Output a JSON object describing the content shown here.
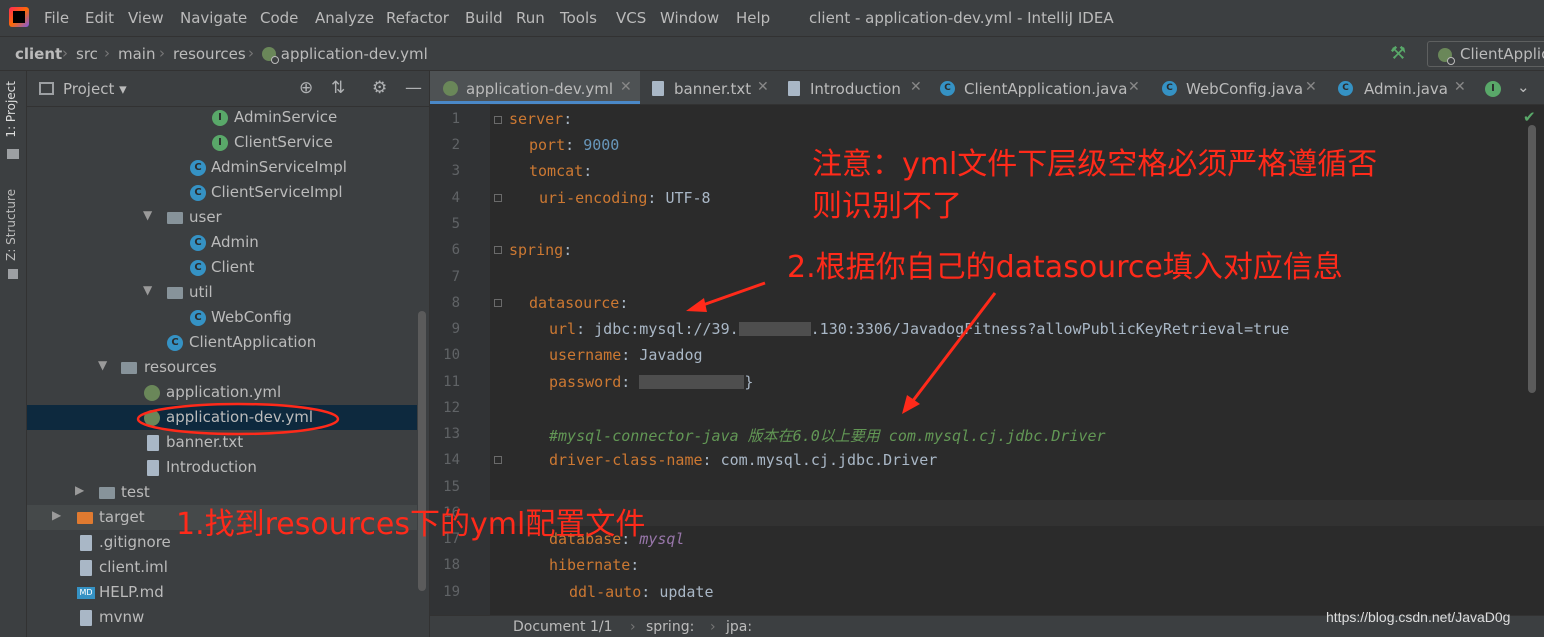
{
  "colors": {
    "accent": "#4a88c7",
    "annotation": "#ff2a1a",
    "selection": "#0d293e"
  },
  "window": {
    "title": "client - application-dev.yml - IntelliJ IDEA"
  },
  "menu": [
    "File",
    "Edit",
    "View",
    "Navigate",
    "Code",
    "Analyze",
    "Refactor",
    "Build",
    "Run",
    "Tools",
    "VCS",
    "Window",
    "Help"
  ],
  "breadcrumb": [
    "client",
    "src",
    "main",
    "resources",
    "application-dev.yml"
  ],
  "run_config": "ClientApplic",
  "left_strip": {
    "project": "1: Project",
    "structure": "Z: Structure"
  },
  "project_panel": {
    "title": "Project"
  },
  "tree": [
    {
      "label": "AdminService",
      "icon": "interface-icon"
    },
    {
      "label": "ClientService",
      "icon": "interface-icon"
    },
    {
      "label": "AdminServiceImpl",
      "icon": "class-icon"
    },
    {
      "label": "ClientServiceImpl",
      "icon": "class-icon"
    },
    {
      "label": "user",
      "icon": "package-icon"
    },
    {
      "label": "Admin",
      "icon": "class-icon"
    },
    {
      "label": "Client",
      "icon": "class-icon"
    },
    {
      "label": "util",
      "icon": "package-icon"
    },
    {
      "label": "WebConfig",
      "icon": "class-icon"
    },
    {
      "label": "ClientApplication",
      "icon": "spring-boot-icon"
    },
    {
      "label": "resources",
      "icon": "resources-folder-icon"
    },
    {
      "label": "application.yml",
      "icon": "yml-icon"
    },
    {
      "label": "application-dev.yml",
      "icon": "yml-icon"
    },
    {
      "label": "banner.txt",
      "icon": "text-file-icon"
    },
    {
      "label": "Introduction",
      "icon": "text-file-icon"
    },
    {
      "label": "test",
      "icon": "folder-icon"
    },
    {
      "label": "target",
      "icon": "excluded-folder-icon"
    },
    {
      "label": ".gitignore",
      "icon": "gitignore-icon"
    },
    {
      "label": "client.iml",
      "icon": "iml-icon"
    },
    {
      "label": "HELP.md",
      "icon": "markdown-icon"
    },
    {
      "label": "mvnw",
      "icon": "script-icon"
    }
  ],
  "tabs": [
    {
      "label": "application-dev.yml",
      "icon": "yml-icon"
    },
    {
      "label": "banner.txt",
      "icon": "text-file-icon"
    },
    {
      "label": "Introduction",
      "icon": "text-file-icon"
    },
    {
      "label": "ClientApplication.java",
      "icon": "spring-boot-icon"
    },
    {
      "label": "WebConfig.java",
      "icon": "class-icon"
    },
    {
      "label": "Admin.java",
      "icon": "class-icon"
    }
  ],
  "code": {
    "l1_key": "server",
    "l2_key": "port",
    "l2_val": "9000",
    "l3_key": "tomcat",
    "l4_key": "uri-encoding",
    "l4_val": "UTF-8",
    "l6_key": "spring",
    "l8_key": "datasource",
    "l9_key": "url",
    "l9_val_a": "jdbc:mysql://39.",
    "l9_val_b": ".130:3306/JavadogFitness?allowPublicKeyRetrieval=true",
    "l10_key": "username",
    "l10_val": "Javadog",
    "l11_key": "password",
    "l11_val_end": "}",
    "l13_comment": "#mysql-connector-java 版本在6.0以上要用 com.mysql.cj.jdbc.Driver",
    "l14_key": "driver-class-name",
    "l14_val": "com.mysql.cj.jdbc.Driver",
    "l17_key": "database",
    "l17_val": "mysql",
    "l18_key": "hibernate",
    "l19_key": "ddl-auto",
    "l19_val": "update",
    "line_numbers": [
      "1",
      "2",
      "3",
      "4",
      "5",
      "6",
      "7",
      "8",
      "9",
      "10",
      "11",
      "12",
      "13",
      "14",
      "15",
      "16",
      "17",
      "18",
      "19"
    ]
  },
  "status": {
    "document": "Document 1/1",
    "crumb1": "spring:",
    "crumb2": "jpa:"
  },
  "annotations": {
    "note_line1": "注意：yml文件下层级空格必须严格遵循否",
    "note_line2": "则识别不了",
    "step2": "2.根据你自己的datasource填入对应信息",
    "step1": "1.找到resources下的yml配置文件"
  },
  "watermark": "https://blog.csdn.net/JavaD0g"
}
